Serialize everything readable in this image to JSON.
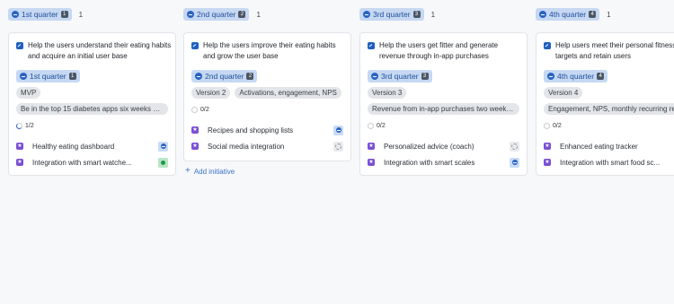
{
  "columns": [
    {
      "quarter": "1st quarter",
      "quarter_num": "1",
      "count": "1",
      "title": "Help the users understand their eating habits and acquire an initial user base",
      "tags": [
        "MVP"
      ],
      "description": "Be in the top 15 diabetes apps six weeks af...",
      "progress": "1/2",
      "items": [
        {
          "label": "Healthy eating dashboard",
          "status": "in-progress"
        },
        {
          "label": "Integration with smart watche...",
          "status": "done"
        }
      ]
    },
    {
      "quarter": "2nd quarter",
      "quarter_num": "2",
      "count": "1",
      "title": "Help the users improve their eating habits and grow the user base",
      "tags": [
        "Version 2",
        "Activations, engagement, NPS"
      ],
      "description": "",
      "progress": "0/2",
      "items": [
        {
          "label": "Recipes and shopping lists",
          "status": "in-progress"
        },
        {
          "label": "Social media integration",
          "status": "not-started"
        }
      ],
      "add_initiative": "Add initiative"
    },
    {
      "quarter": "3rd quarter",
      "quarter_num": "3",
      "count": "1",
      "title": "Help the users get fitter and generate revenue through in-app purchases",
      "tags": [
        "Version 3"
      ],
      "description": "Revenue from in-app purchases two weeks...",
      "progress": "0/2",
      "items": [
        {
          "label": "Personalized advice (coach)",
          "status": "not-started"
        },
        {
          "label": "Integration with smart scales",
          "status": "in-progress"
        }
      ]
    },
    {
      "quarter": "4th quarter",
      "quarter_num": "4",
      "count": "1",
      "title": "Help users meet their personal fitness targets and retain users",
      "tags": [
        "Version 4"
      ],
      "description": "Engagement, NPS, monthly recurring reve...",
      "progress": "0/2",
      "items": [
        {
          "label": "Enhanced eating tracker",
          "status": "none"
        },
        {
          "label": "Integration with smart food sc...",
          "status": "none"
        }
      ]
    }
  ],
  "colors": {
    "accent": "#2a63c4",
    "item_icon": "#7a50d6",
    "card_border": "#e1e4e8"
  }
}
